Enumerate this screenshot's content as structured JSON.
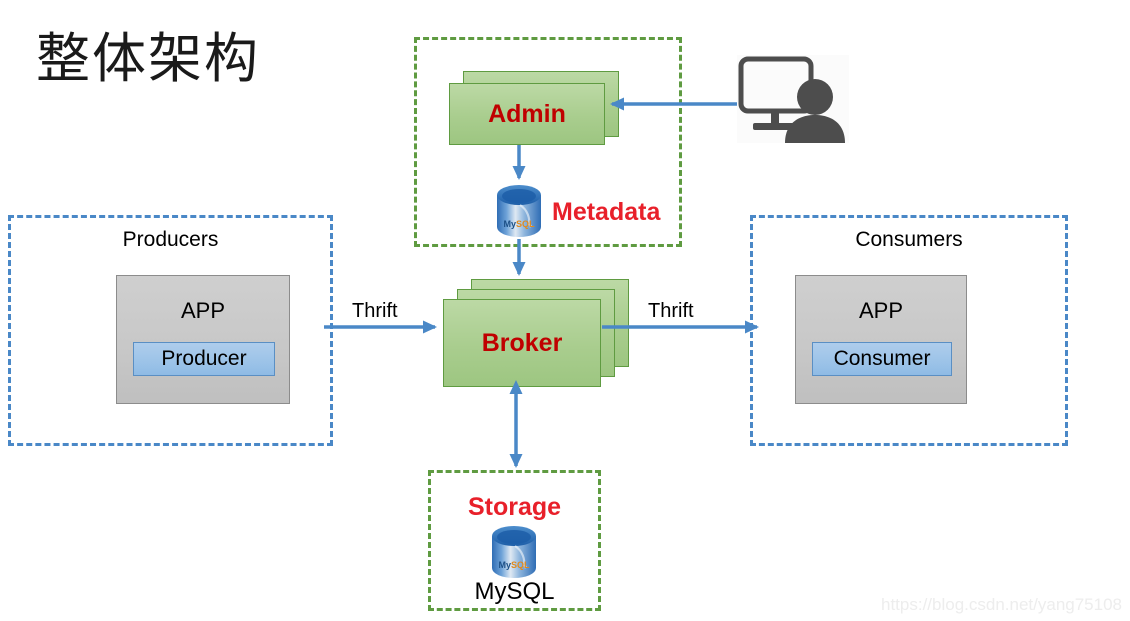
{
  "page": {
    "title": "整体架构",
    "watermark": "https://blog.csdn.net/yang75108"
  },
  "colors": {
    "green_fill": "#a9cd8e",
    "green_border": "#5f9b41",
    "blue_border": "#4a88c7",
    "arrow_blue": "#4a88c7",
    "red_text": "#c00000",
    "label_red": "#e8202a",
    "gray_fill": "#c8c8c8",
    "inner_blue": "#9cc3e8",
    "watermark_gray": "#ededed"
  },
  "groups": {
    "producers": {
      "label": "Producers",
      "app_label": "APP",
      "inner_label": "Producer"
    },
    "consumers": {
      "label": "Consumers",
      "app_label": "APP",
      "inner_label": "Consumer"
    },
    "admin_zone": {
      "node_label": "Admin",
      "db_label": "Metadata",
      "db_icon": "mysql-database-icon"
    },
    "storage_zone": {
      "title": "Storage",
      "db_label": "MySQL",
      "db_icon": "mysql-database-icon"
    }
  },
  "nodes": {
    "broker": {
      "label": "Broker",
      "stack_count": 3
    },
    "admin": {
      "label": "Admin",
      "stack_count": 2
    }
  },
  "edges": [
    {
      "name": "producer-to-broker",
      "label": "Thrift",
      "direction": "right"
    },
    {
      "name": "broker-to-consumer",
      "label": "Thrift",
      "direction": "right"
    },
    {
      "name": "admin-to-metadata",
      "label": "",
      "direction": "down"
    },
    {
      "name": "metadata-to-broker",
      "label": "",
      "direction": "down"
    },
    {
      "name": "broker-to-storage",
      "label": "",
      "direction": "both"
    },
    {
      "name": "user-to-admin",
      "label": "",
      "direction": "left"
    }
  ],
  "icons": {
    "user_terminal": "user-monitor-icon"
  }
}
